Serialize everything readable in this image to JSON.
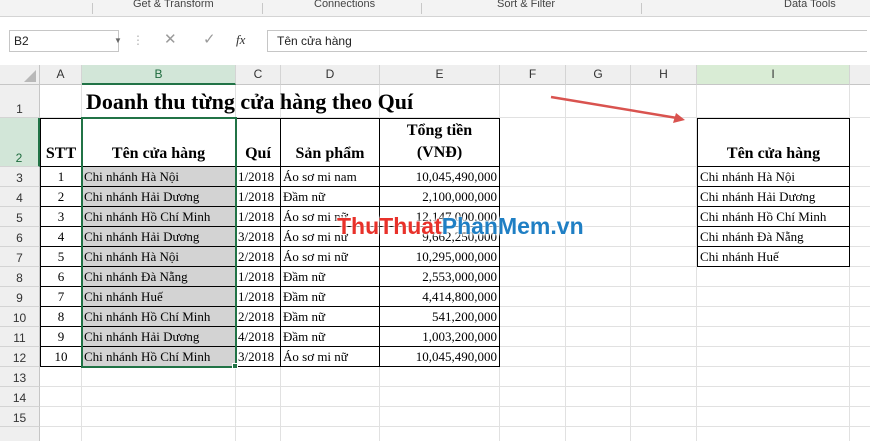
{
  "ribbon": {
    "groups": [
      "Get & Transform",
      "Connections",
      "Sort & Filter",
      "Data Tools"
    ]
  },
  "formula_bar": {
    "name_box": "B2",
    "fx_label": "fx",
    "formula": "Tên cửa hàng"
  },
  "columns": [
    "A",
    "B",
    "C",
    "D",
    "E",
    "F",
    "G",
    "H",
    "I"
  ],
  "rows": [
    "1",
    "2",
    "3",
    "4",
    "5",
    "6",
    "7",
    "8",
    "9",
    "10",
    "11",
    "12",
    "13",
    "14",
    "15"
  ],
  "sheet": {
    "title": "Doanh thu từng cửa hàng theo Quí",
    "headers": {
      "stt": "STT",
      "store": "Tên cửa hàng",
      "quarter": "Quí",
      "product": "Sản phẩm",
      "total_line1": "Tổng tiền",
      "total_line2": "(VNĐ)"
    },
    "rows": [
      {
        "stt": "1",
        "store": "Chi nhánh Hà Nội",
        "quarter": "1/2018",
        "product": "Áo sơ mi nam",
        "total": "10,045,490,000"
      },
      {
        "stt": "2",
        "store": "Chi nhánh Hải Dương",
        "quarter": "1/2018",
        "product": "Đầm nữ",
        "total": "2,100,000,000"
      },
      {
        "stt": "3",
        "store": "Chi nhánh Hồ Chí Minh",
        "quarter": "1/2018",
        "product": "Áo sơ mi nữ",
        "total": "12,147,000,000"
      },
      {
        "stt": "4",
        "store": "Chi nhánh Hải Dương",
        "quarter": "3/2018",
        "product": "Áo sơ mi nữ",
        "total": "9,662,250,000"
      },
      {
        "stt": "5",
        "store": "Chi nhánh Hà Nội",
        "quarter": "2/2018",
        "product": "Áo sơ mi nữ",
        "total": "10,295,000,000"
      },
      {
        "stt": "6",
        "store": "Chi nhánh Đà Nẵng",
        "quarter": "1/2018",
        "product": "Đầm nữ",
        "total": "2,553,000,000"
      },
      {
        "stt": "7",
        "store": "Chi nhánh Huế",
        "quarter": "1/2018",
        "product": "Đầm nữ",
        "total": "4,414,800,000"
      },
      {
        "stt": "8",
        "store": "Chi nhánh Hồ Chí Minh",
        "quarter": "2/2018",
        "product": "Đầm nữ",
        "total": "541,200,000"
      },
      {
        "stt": "9",
        "store": "Chi nhánh Hải Dương",
        "quarter": "4/2018",
        "product": "Đầm nữ",
        "total": "1,003,200,000"
      },
      {
        "stt": "10",
        "store": "Chi nhánh Hồ Chí Minh",
        "quarter": "3/2018",
        "product": "Áo sơ mi nữ",
        "total": "10,045,490,000"
      }
    ],
    "unique_header": "Tên cửa hàng",
    "unique_list": [
      "Chi nhánh Hà Nội",
      "Chi nhánh Hải Dương",
      "Chi nhánh Hồ Chí Minh",
      "Chi nhánh Đà Nẵng",
      "Chi nhánh Huế"
    ]
  },
  "watermark": {
    "part1": "ThuThuat",
    "part2": "PhanMem",
    "part3": ".vn"
  },
  "colors": {
    "selection_green": "#217346",
    "arrow": "#d9534f",
    "highlight_gray": "#d3d3d3",
    "watermark_red": "#e8312a",
    "watermark_blue": "#1f7fc4"
  }
}
